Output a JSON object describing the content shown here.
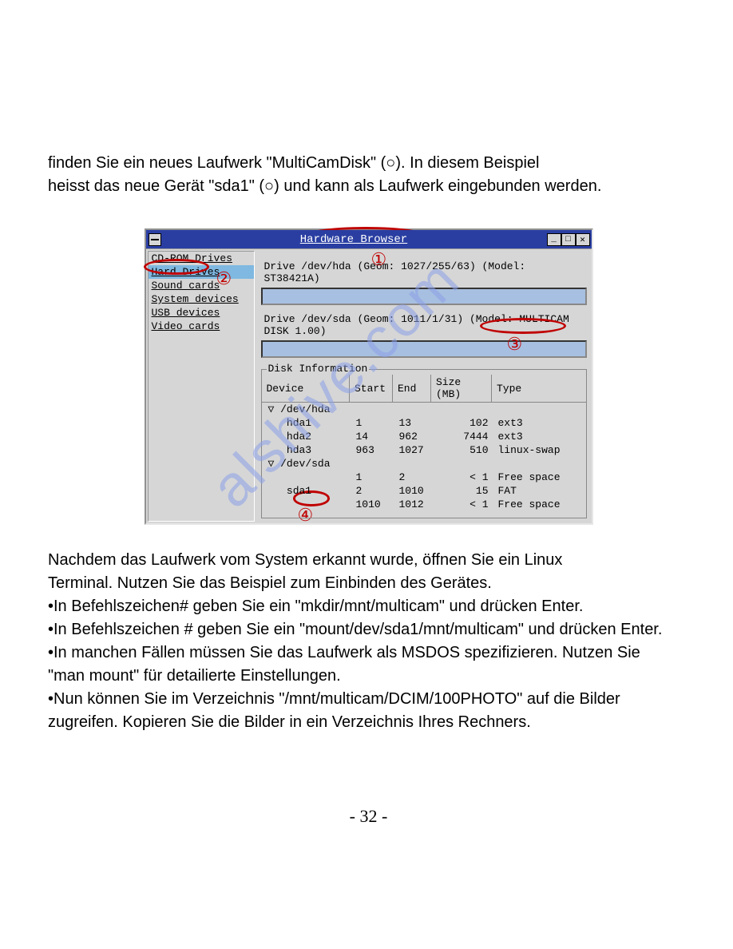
{
  "intro": {
    "line1_a": "finden Sie ein neues Laufwerk \"MultiCamDisk\" (",
    "line1_b": "). In diesem Beispiel",
    "line2_a": "heisst das neue Gerät \"sda1\" (",
    "line2_b": ") und kann als Laufwerk eingebunden werden."
  },
  "hw": {
    "title": "Hardware Browser",
    "sidebar": {
      "items": [
        {
          "label": "CD-ROM Drives",
          "selected": false
        },
        {
          "label": "Hard Drives",
          "selected": true
        },
        {
          "label": "Sound cards",
          "selected": false
        },
        {
          "label": "System devices",
          "selected": false
        },
        {
          "label": "USB devices",
          "selected": false
        },
        {
          "label": "Video cards",
          "selected": false
        }
      ]
    },
    "drives": [
      {
        "label": "Drive /dev/hda (Geom: 1027/255/63) (Model: ST38421A)"
      },
      {
        "label": "Drive /dev/sda (Geom: 1011/1/31) (Model: MULTICAM DISK 1.00)"
      }
    ],
    "diskinfo": {
      "legend": "Disk Information",
      "headers": [
        "Device",
        "Start",
        "End",
        "Size (MB)",
        "Type"
      ],
      "rows": [
        {
          "device": "▽ /dev/hda",
          "start": "",
          "end": "",
          "size": "",
          "type": ""
        },
        {
          "device": "   hda1",
          "start": "1",
          "end": "13",
          "size": "102",
          "type": "ext3"
        },
        {
          "device": "   hda2",
          "start": "14",
          "end": "962",
          "size": "7444",
          "type": "ext3"
        },
        {
          "device": "   hda3",
          "start": "963",
          "end": "1027",
          "size": "510",
          "type": "linux-swap"
        },
        {
          "device": "▽ /dev/sda",
          "start": "",
          "end": "",
          "size": "",
          "type": ""
        },
        {
          "device": "",
          "start": "1",
          "end": "2",
          "size": "< 1",
          "type": "Free space"
        },
        {
          "device": "   sda1",
          "start": "2",
          "end": "1010",
          "size": "15",
          "type": "FAT"
        },
        {
          "device": "",
          "start": "1010",
          "end": "1012",
          "size": "< 1",
          "type": "Free space"
        }
      ]
    }
  },
  "annotations": {
    "n1": "①",
    "n2": "②",
    "n3": "③",
    "n4": "④"
  },
  "outro": {
    "p1": "Nachdem das Laufwerk vom System erkannt wurde, öffnen Sie ein Linux",
    "p2": "Terminal. Nutzen Sie das Beispiel zum Einbinden des Gerätes.",
    "p3": "•In Befehlszeichen# geben Sie ein \"mkdir/mnt/multicam\" und drücken Enter.",
    "p4": "•In Befehlszeichen # geben Sie ein \"mount/dev/sda1/mnt/multicam\" und drücken Enter.",
    "p5": "•In manchen Fällen müssen Sie das Laufwerk als MSDOS spezifizieren. Nutzen Sie",
    "p6": "\"man mount\" für detailierte Einstellungen.",
    "p7": "•Nun können Sie im Verzeichnis \"/mnt/multicam/DCIM/100PHOTO\" auf die Bilder",
    "p8": " zugreifen. Kopieren Sie die Bilder in ein Verzeichnis Ihres Rechners."
  },
  "pagenum": "- 32 -",
  "watermark": "alshive.com"
}
